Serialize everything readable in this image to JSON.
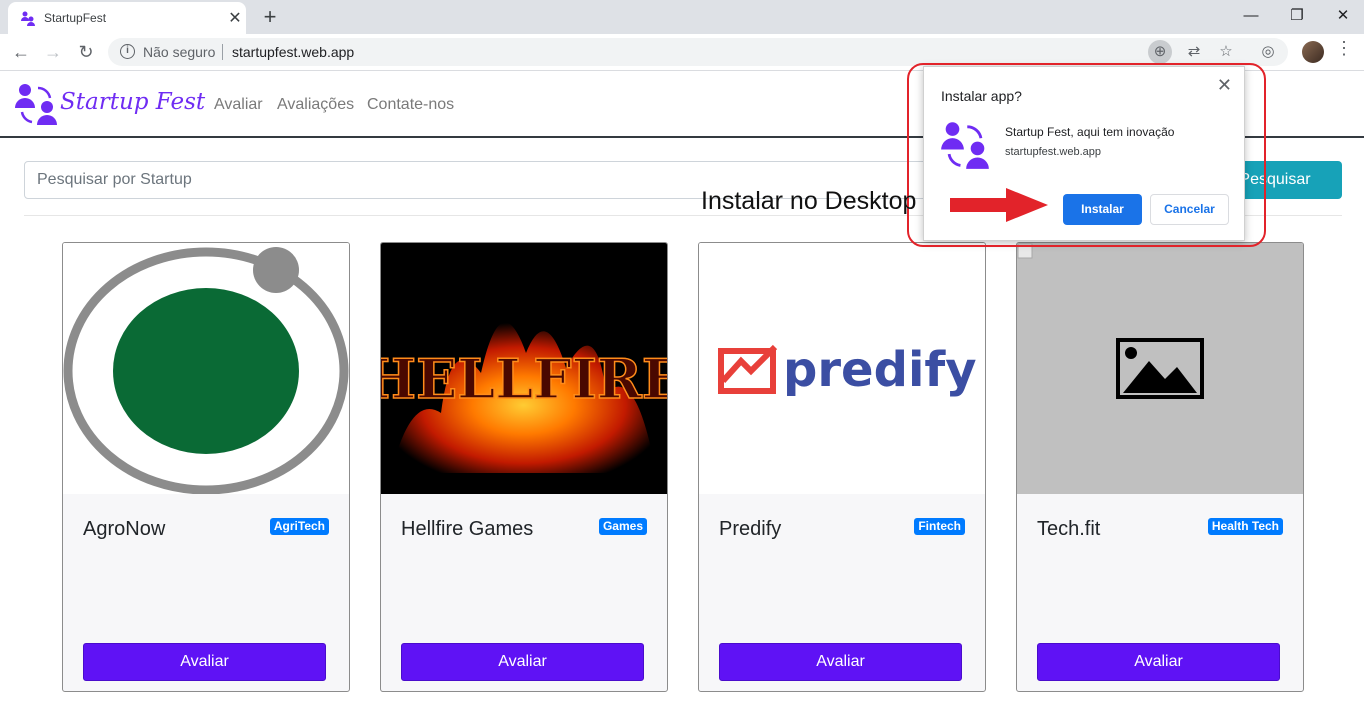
{
  "browser": {
    "tab_title": "StartupFest",
    "tab_close": "✕",
    "new_tab": "+",
    "window": {
      "minimize": "—",
      "restore": "❐",
      "close": "✕"
    },
    "security_label": "Não seguro",
    "url": "startupfest.web.app"
  },
  "site": {
    "logo_text": "Startup Fest",
    "nav_links": [
      "Avaliar",
      "Avaliações",
      "Contate-nos"
    ],
    "search": {
      "placeholder": "Pesquisar por Startup",
      "button_label": "Pesquisar"
    }
  },
  "cards": [
    {
      "title": "AgroNow",
      "badge": "AgriTech",
      "button": "Avaliar",
      "image": "agronow-logo"
    },
    {
      "title": "Hellfire Games",
      "badge": "Games",
      "button": "Avaliar",
      "image": "hellfire-logo",
      "image_text": "HELLFIRE"
    },
    {
      "title": "Predify",
      "badge": "Fintech",
      "button": "Avaliar",
      "image": "predify-logo",
      "image_text": "predify"
    },
    {
      "title": "Tech.fit",
      "badge": "Health Tech",
      "button": "Avaliar",
      "image": "broken-image-placeholder"
    }
  ],
  "install_popup": {
    "title": "Instalar app?",
    "close": "✕",
    "app_name": "Startup Fest, aqui tem inovação",
    "app_url": "startupfest.web.app",
    "install_label": "Instalar",
    "cancel_label": "Cancelar"
  },
  "annotation": {
    "text": "Instalar no Desktop",
    "color": "#e2232a"
  },
  "colors": {
    "brand_purple": "#6f2cf3",
    "button_purple": "#5f12f5",
    "badge_blue": "#007bff",
    "search_teal": "#17a2b8",
    "chrome_blue": "#1a73e8"
  }
}
